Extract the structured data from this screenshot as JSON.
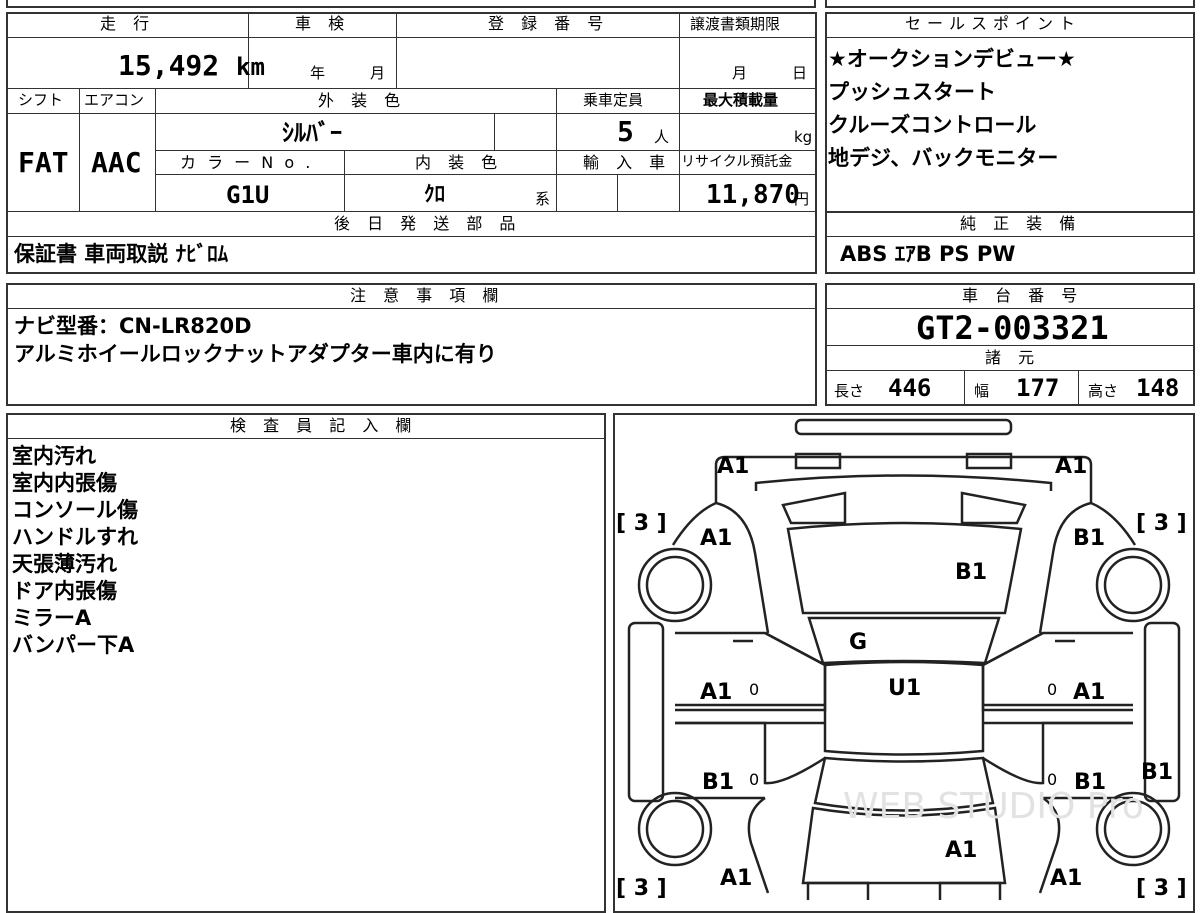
{
  "headers": {
    "mileage": "走 行",
    "inspection": "車 検",
    "registration": "登 録 番 号",
    "transfer_deadline": "譲渡書類期限",
    "sales_points": "セールスポイント",
    "shift": "シフト",
    "aircon": "エアコン",
    "exterior_color": "外 装 色",
    "capacity": "乗車定員",
    "max_load": "最大積載量",
    "color_no": "カ ラ ー N o .",
    "interior_color": "内 装 色",
    "import": "輸 入 車",
    "recycle_fee": "リサイクル預託金",
    "later_parts": "後 日 発 送 部 品",
    "standard_equipment": "純 正 装 備",
    "notes": "注 意 事 項 欄",
    "chassis_no": "車 台 番 号",
    "specs": "諸 元",
    "inspector": "検 査 員 記 入 欄"
  },
  "values": {
    "mileage": "15,492",
    "mileage_unit": "km",
    "inspection_year": "年",
    "inspection_month": "月",
    "transfer_month": "月",
    "transfer_day": "日",
    "shift": "FAT",
    "aircon": "AAC",
    "exterior_color": "ｼﾙﾊﾞｰ",
    "capacity": "5",
    "capacity_unit": "人",
    "max_load_unit": "kg",
    "color_no": "G1U",
    "interior_color": "ｸﾛ",
    "interior_suffix": "系",
    "recycle_fee": "11,870",
    "recycle_unit": "円",
    "later_parts": "保証書 車両取説 ﾅﾋﾞﾛﾑ",
    "standard_equipment": "ABS ｴｱB PS PW",
    "chassis_no": "GT2-003321",
    "length_label": "長さ",
    "length": "446",
    "width_label": "幅",
    "width": "177",
    "height_label": "高さ",
    "height": "148"
  },
  "sales_points": [
    "★オークションデビュー★",
    "プッシュスタート",
    "クルーズコントロール",
    "地デジ、バックモニター"
  ],
  "notes": [
    "ナビ型番：CN-LR820D",
    "アルミホイールロックナットアダプター車内に有り"
  ],
  "inspector_notes": [
    "室内汚れ",
    "室内内張傷",
    "コンソール傷",
    "ハンドルすれ",
    "天張薄汚れ",
    "ドア内張傷",
    "ミラーA",
    "バンパー下A"
  ],
  "diagram": {
    "codes": {
      "front_left": "A1",
      "front_right": "A1",
      "fender_left": "A1",
      "fender_right": "B1",
      "hood": "B1",
      "windshield": "G",
      "roof": "U1",
      "front_door_left": "A1",
      "front_door_right": "A1",
      "rear_door_left": "B1",
      "rear_door_right": "B1",
      "rear_side_right": "B1",
      "trunk": "A1",
      "rear_left": "A1",
      "rear_right": "A1"
    },
    "tire_marks": [
      "[ 3 ]",
      "[ 3 ]",
      "[ 3 ]",
      "[ 3 ]"
    ],
    "pillar_marks": [
      "0",
      "0",
      "0",
      "0"
    ],
    "watermark": "WEB STUDIO Pro"
  }
}
